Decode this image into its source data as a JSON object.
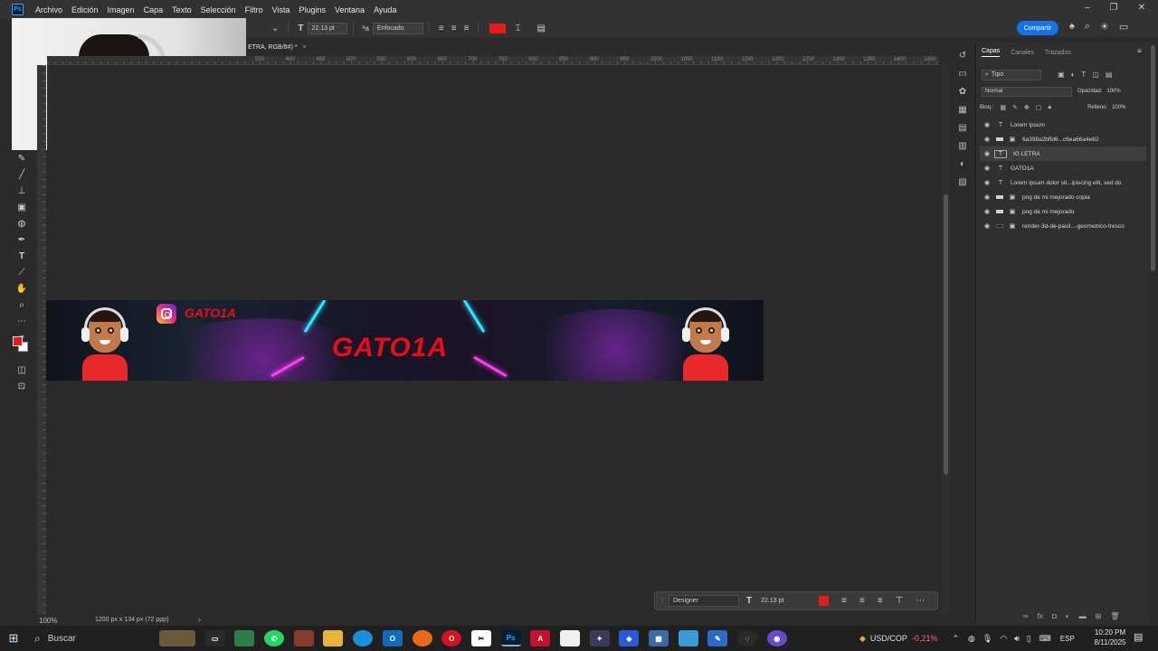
{
  "menu": [
    "Archivo",
    "Edición",
    "Imagen",
    "Capa",
    "Texto",
    "Selección",
    "Filtro",
    "Vista",
    "Plugins",
    "Ventana",
    "Ayuda"
  ],
  "app_logo": "Ps",
  "options": {
    "font_size": "22.13 pt",
    "aa_label": "ªa",
    "antialias": "Enfocado",
    "text_color": "#e41b17",
    "share": "Compartir"
  },
  "document_tab": {
    "title": "ETRA, RGB/8#) *",
    "close": "×"
  },
  "ruler_ticks": [
    "550",
    "400",
    "450",
    "500",
    "550",
    "600",
    "650",
    "700",
    "750",
    "800",
    "850",
    "900",
    "950",
    "1000",
    "1050",
    "1100",
    "1150",
    "1200",
    "1250",
    "1300",
    "1350",
    "1400",
    "1450"
  ],
  "banner": {
    "title": "GATO1A",
    "ig_name": "GATO1A",
    "colors": {
      "title": "#e0101f",
      "shirt": "#e8282b",
      "neon_cyan": "#2fe6ff",
      "neon_pink": "#ff3df5"
    }
  },
  "status": {
    "zoom": "100%",
    "doc_size": "1200 px x 134 px (72 ppp)",
    "arrow": "›"
  },
  "context_bar": {
    "font": "Designer",
    "size": "22.13 pt",
    "color": "#e41b17"
  },
  "panel": {
    "tabs": [
      "Capas",
      "Canales",
      "Trazados"
    ],
    "filter": "Tipo",
    "blend": "Normal",
    "opacity_label": "Opacidad:",
    "opacity": "100%",
    "lock_label": "Bloq.:",
    "fill_label": "Relleno:",
    "fill": "100%",
    "layers": [
      {
        "name": "Lorem Ipsum",
        "type": "text",
        "selected": false
      },
      {
        "name": "6a398a2bffd6...c6ea66a4e62",
        "type": "smart",
        "selected": false
      },
      {
        "name": "IG LETRA",
        "type": "text",
        "selected": true
      },
      {
        "name": "GATO1A",
        "type": "text",
        "selected": false
      },
      {
        "name": "Lorem ipsum dolor sit...ipiscing elit, sed do",
        "type": "text",
        "selected": false
      },
      {
        "name": "png de mi mejorado copia",
        "type": "smart",
        "selected": false
      },
      {
        "name": "png de mi mejorado",
        "type": "smart",
        "selected": false
      },
      {
        "name": "render-3d-de-pasil...-geometrico-fresco",
        "type": "smart-dark",
        "selected": false
      }
    ]
  },
  "taskbar": {
    "search": "Buscar",
    "currency": "USD/COP",
    "currency_change": "-0,21%",
    "language": "ESP",
    "time": "10:20 PM",
    "date": "8/11/2025"
  }
}
